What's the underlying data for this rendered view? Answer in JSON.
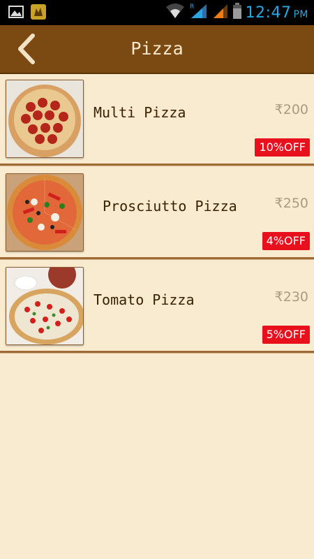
{
  "status_bar": {
    "time": "12:47",
    "ampm": "PM",
    "icons": [
      "gallery-icon",
      "app-notification-icon",
      "wifi-icon",
      "signal-icon",
      "signal-icon-2",
      "battery-icon"
    ],
    "colors": {
      "clock": "#2aa7e0"
    }
  },
  "header": {
    "title": "Pizza",
    "back_icon": "chevron-left-icon",
    "colors": {
      "background": "#7b4a12",
      "title": "#fbead0"
    }
  },
  "items": [
    {
      "name": "Multi Pizza",
      "price": "₹200",
      "discount": "10%OFF",
      "image": "pepperoni-pizza-image"
    },
    {
      "name": "Prosciutto Pizza",
      "price": "₹250",
      "discount": "4%OFF",
      "image": "prosciutto-pizza-image"
    },
    {
      "name": "Tomato Pizza",
      "price": "₹230",
      "discount": "5%OFF",
      "image": "tomato-pizza-image"
    }
  ],
  "colors": {
    "page_background": "#f8ebcf",
    "badge": "#e8101c",
    "divider": "#a06a35"
  }
}
